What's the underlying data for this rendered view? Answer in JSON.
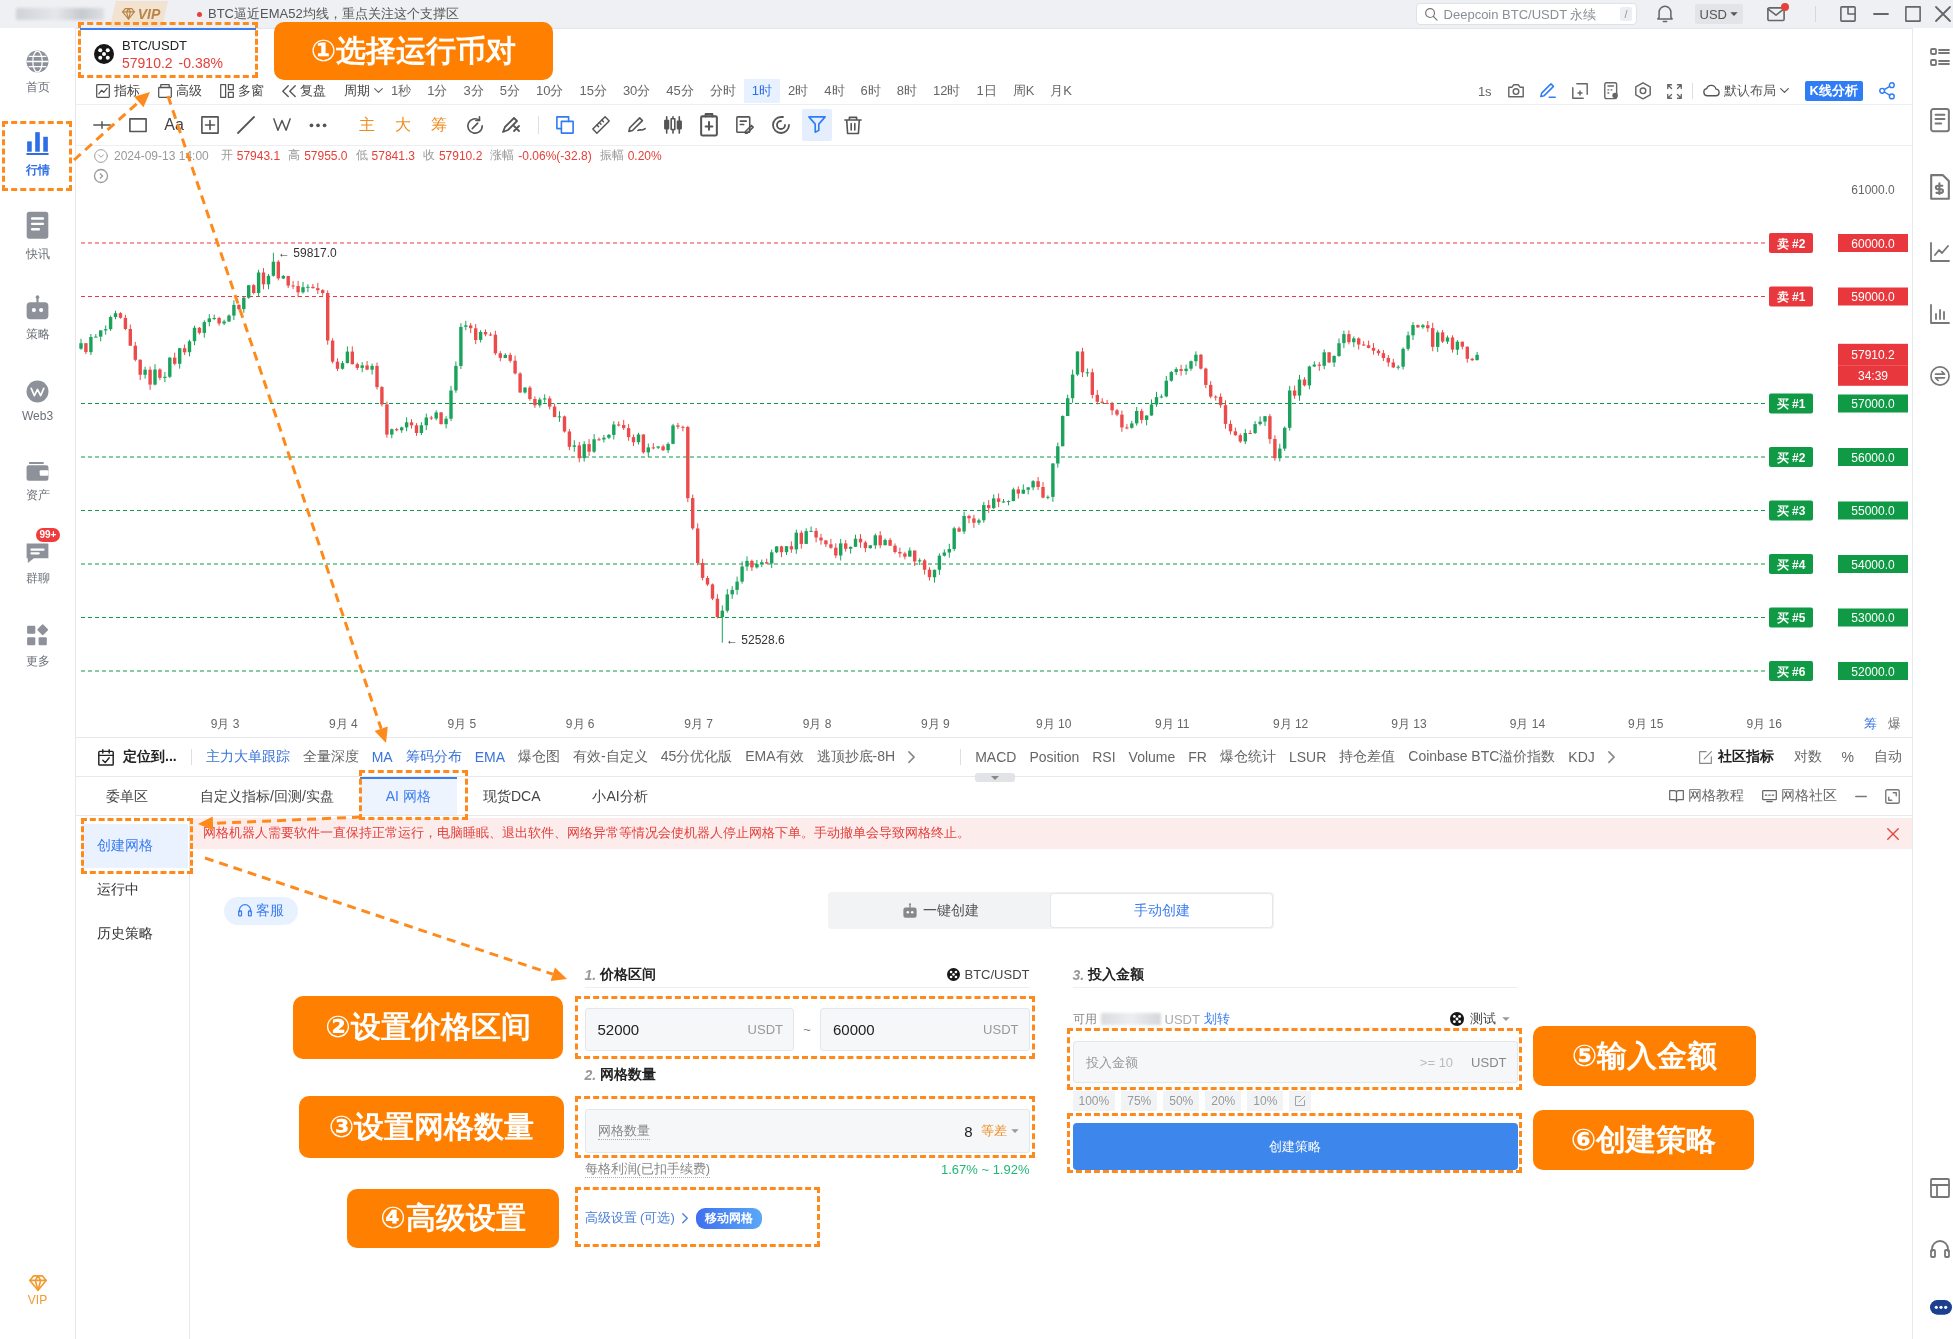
{
  "top_bar": {
    "vip": "VIP",
    "news": "BTC逼近EMA52均线，重点关注这个支撑区",
    "search": {
      "placeholder": "Deepcoin BTC/USDT 永续",
      "shortcut": "/"
    },
    "currency": "USD",
    "mail_unread": true
  },
  "sidebar": {
    "items": [
      {
        "label": "首页",
        "selected": false
      },
      {
        "label": "行情",
        "selected": true
      },
      {
        "label": "快讯",
        "selected": false
      },
      {
        "label": "策略",
        "selected": false
      },
      {
        "label": "Web3",
        "selected": false
      },
      {
        "label": "资产",
        "selected": false
      },
      {
        "label": "群聊",
        "selected": false,
        "badge": "99+"
      },
      {
        "label": "更多",
        "selected": false
      }
    ],
    "vip": "VIP"
  },
  "symbol": {
    "pair": "BTC/USDT",
    "price": "57910.2",
    "change": "-0.38%"
  },
  "toolbar": {
    "tools": [
      "指标",
      "高级",
      "多窗",
      "复盘"
    ],
    "period_menu": "周期",
    "intervals": [
      {
        "label": "1秒",
        "selected": false
      },
      {
        "label": "1分",
        "selected": false
      },
      {
        "label": "3分",
        "selected": false
      },
      {
        "label": "5分",
        "selected": false
      },
      {
        "label": "10分",
        "selected": false
      },
      {
        "label": "15分",
        "selected": false
      },
      {
        "label": "30分",
        "selected": false
      },
      {
        "label": "45分",
        "selected": false
      },
      {
        "label": "分时",
        "selected": false
      },
      {
        "label": "1时",
        "selected": true
      },
      {
        "label": "2时",
        "selected": false
      },
      {
        "label": "4时",
        "selected": false
      },
      {
        "label": "6时",
        "selected": false
      },
      {
        "label": "8时",
        "selected": false
      },
      {
        "label": "12时",
        "selected": false
      },
      {
        "label": "1日",
        "selected": false
      },
      {
        "label": "周K",
        "selected": false
      },
      {
        "label": "月K",
        "selected": false
      }
    ],
    "refresh_rate": "1s",
    "layout_menu": "默认布局",
    "analysis_button": "K线分析"
  },
  "drawing_tools": {
    "text_tool": "Aa",
    "overlays": [
      "主",
      "大",
      "筹"
    ],
    "filter_on": true
  },
  "ohlc": {
    "time": "2024-09-13 14:00",
    "fields": [
      {
        "label": "开",
        "value": "57943.1"
      },
      {
        "label": "高",
        "value": "57955.0"
      },
      {
        "label": "低",
        "value": "57841.3"
      },
      {
        "label": "收",
        "value": "57910.2"
      },
      {
        "label": "涨幅",
        "value": "-0.06%(-32.8)"
      },
      {
        "label": "振幅",
        "value": "0.20%"
      }
    ]
  },
  "chart": {
    "axis_tick": "61000.0",
    "levels": [
      {
        "kind": "sell",
        "tag": "卖 #2",
        "price": "60000.0"
      },
      {
        "kind": "sell",
        "tag": "卖 #1",
        "price": "59000.0"
      },
      {
        "kind": "buy",
        "tag": "买 #1",
        "price": "57000.0"
      },
      {
        "kind": "buy",
        "tag": "买 #2",
        "price": "56000.0"
      },
      {
        "kind": "buy",
        "tag": "买 #3",
        "price": "55000.0"
      },
      {
        "kind": "buy",
        "tag": "买 #4",
        "price": "54000.0"
      },
      {
        "kind": "buy",
        "tag": "买 #5",
        "price": "53000.0"
      },
      {
        "kind": "buy",
        "tag": "买 #6",
        "price": "52000.0"
      }
    ],
    "current_price": "57910.2",
    "countdown": "34:39",
    "high_marker": "← 59817.0",
    "low_marker": "← 52528.6",
    "dates": [
      "9月 3",
      "9月 4",
      "9月 5",
      "9月 6",
      "9月 7",
      "9月 8",
      "9月 9",
      "9月 10",
      "9月 11",
      "9月 12",
      "9月 13",
      "9月 14",
      "9月 15",
      "9月 16"
    ],
    "corner_tools": [
      {
        "label": "筹",
        "active": true
      },
      {
        "label": "爆",
        "active": false
      }
    ]
  },
  "indicator_bar": {
    "locate": "定位到...",
    "primary": [
      {
        "label": "主力大单跟踪",
        "active": true
      },
      {
        "label": "全量深度",
        "active": false
      },
      {
        "label": "MA",
        "active": true
      },
      {
        "label": "筹码分布",
        "active": true
      },
      {
        "label": "EMA",
        "active": true
      },
      {
        "label": "爆仓图",
        "active": false
      },
      {
        "label": "有效-自定义",
        "active": false
      },
      {
        "label": "45分优化版",
        "active": false
      },
      {
        "label": "EMA有效",
        "active": false
      },
      {
        "label": "逃顶抄底-8H",
        "active": false
      }
    ],
    "secondary": [
      {
        "label": "MACD",
        "active": false
      },
      {
        "label": "Position",
        "active": false
      },
      {
        "label": "RSI",
        "active": false
      },
      {
        "label": "Volume",
        "active": false
      },
      {
        "label": "FR",
        "active": false
      },
      {
        "label": "爆仓统计",
        "active": false
      },
      {
        "label": "LSUR",
        "active": false
      },
      {
        "label": "持仓差值",
        "active": false
      },
      {
        "label": "Coinbase BTC溢价指数",
        "active": false
      },
      {
        "label": "KDJ",
        "active": false
      }
    ],
    "community": "社区指标",
    "options": [
      "对数",
      "%",
      "自动"
    ]
  },
  "bottom_panel": {
    "tabs": [
      {
        "label": "委单区",
        "selected": false
      },
      {
        "label": "自定义指标/回测/实盘",
        "selected": false
      },
      {
        "label": "AI 网格",
        "selected": true
      },
      {
        "label": "现货DCA",
        "selected": false
      },
      {
        "label": "小AI分析",
        "selected": false
      }
    ],
    "links": [
      "网格教程",
      "网格社区"
    ]
  },
  "grid_bot": {
    "nav": [
      {
        "label": "创建网格",
        "selected": true
      },
      {
        "label": "运行中",
        "selected": false
      },
      {
        "label": "历史策略",
        "selected": false
      }
    ],
    "alert": "网格机器人需要软件一直保持正常运行，电脑睡眠、退出软件、网络异常等情况会使机器人停止网格下单。手动撤单会导致网格终止。",
    "support_button": "客服",
    "modes": [
      {
        "label": "一键创建",
        "selected": false
      },
      {
        "label": "手动创建",
        "selected": true
      }
    ],
    "price_range": {
      "step": "1.",
      "title": "价格区间",
      "pair": "BTC/USDT",
      "low": {
        "value": "52000",
        "unit": "USDT"
      },
      "separator": "~",
      "high": {
        "value": "60000",
        "unit": "USDT"
      }
    },
    "grid_count": {
      "step": "2.",
      "title": "网格数量",
      "label": "网格数量",
      "value": "8",
      "spacing": "等差",
      "profit_label": "每格利润(已扣手续费)",
      "profit": "1.67% ~ 1.92%"
    },
    "advanced": {
      "link": "高级设置 (可选)",
      "badge": "移动网格"
    },
    "investment": {
      "step": "3.",
      "title": "投入金额",
      "available_label": "可用",
      "available_unit": "USDT",
      "transfer": "划转",
      "account": "测试",
      "placeholder": "投入金额",
      "minimum": ">= 10",
      "unit": "USDT",
      "percents": [
        "100%",
        "75%",
        "50%",
        "20%",
        "10%"
      ],
      "submit": "创建策略"
    }
  },
  "callouts": [
    "①选择运行币对",
    "②设置价格区间",
    "③设置网格数量",
    "④高级设置",
    "⑤输入金额",
    "⑥创建策略"
  ]
}
